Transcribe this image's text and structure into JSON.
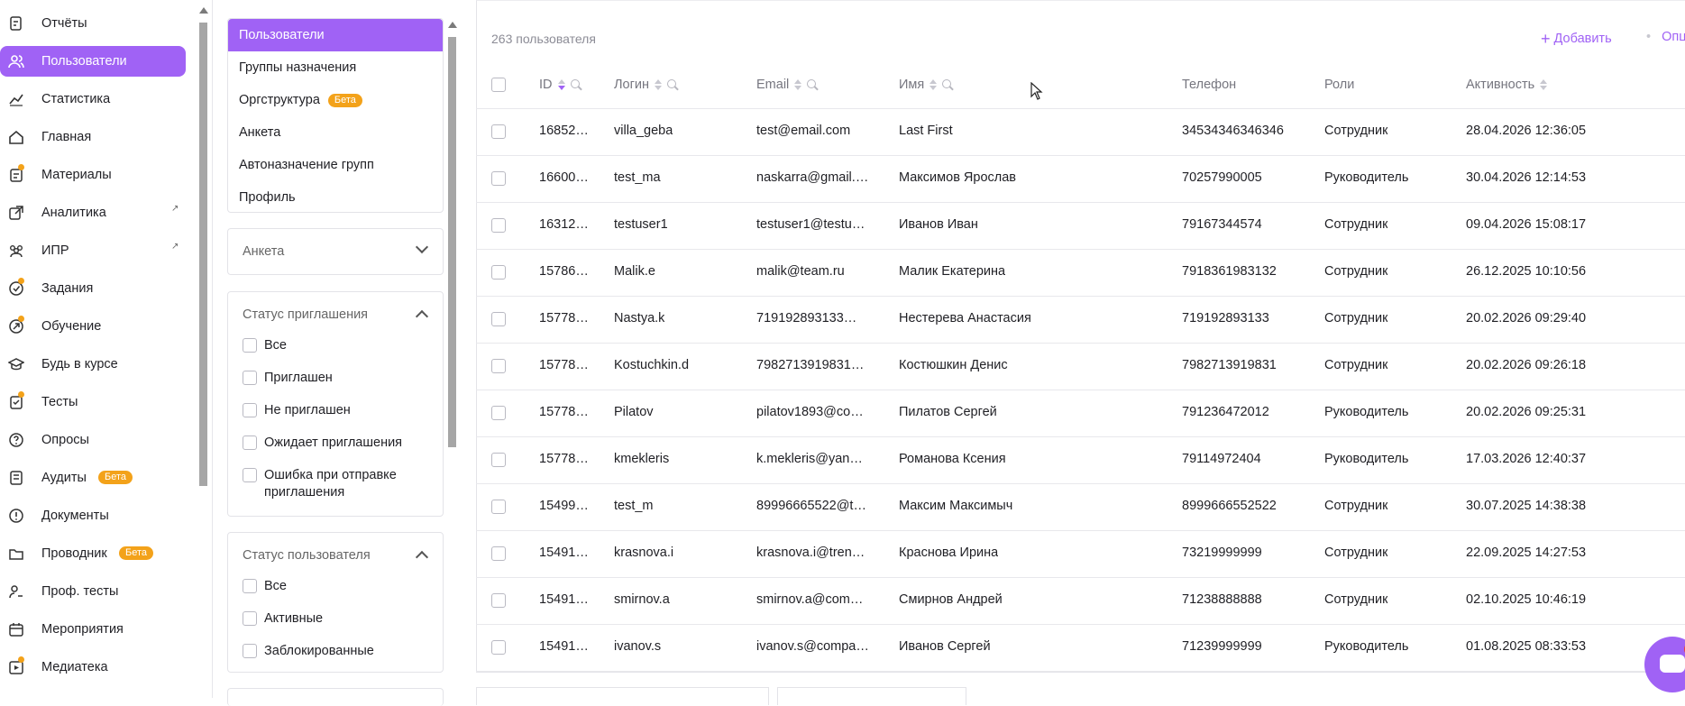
{
  "sidebar": {
    "items": [
      {
        "label": "Отчёты",
        "icon": "report-icon"
      },
      {
        "label": "Пользователи",
        "icon": "users-icon",
        "active": true
      },
      {
        "label": "Статистика",
        "icon": "chart-line-icon"
      },
      {
        "label": "Главная",
        "icon": "home-icon"
      },
      {
        "label": "Материалы",
        "icon": "materials-icon",
        "notification": true
      },
      {
        "label": "Аналитика",
        "icon": "analytics-icon",
        "external": "↗"
      },
      {
        "label": "ИПР",
        "icon": "team-icon",
        "external": "↗"
      },
      {
        "label": "Задания",
        "icon": "tasks-icon",
        "notification": true
      },
      {
        "label": "Обучение",
        "icon": "learning-icon",
        "notification": true
      },
      {
        "label": "Будь в курсе",
        "icon": "graduation-cap-icon"
      },
      {
        "label": "Тесты",
        "icon": "tests-icon",
        "notification": true
      },
      {
        "label": "Опросы",
        "icon": "survey-icon"
      },
      {
        "label": "Аудиты",
        "icon": "audit-icon",
        "badge": "Бета"
      },
      {
        "label": "Документы",
        "icon": "document-icon"
      },
      {
        "label": "Проводник",
        "icon": "folder-icon",
        "badge": "Бета"
      },
      {
        "label": "Проф. тесты",
        "icon": "prof-test-icon"
      },
      {
        "label": "Мероприятия",
        "icon": "calendar-icon"
      },
      {
        "label": "Медиатека",
        "icon": "media-icon",
        "notification": true
      }
    ]
  },
  "tabs": [
    {
      "label": "Пользователи",
      "active": true
    },
    {
      "label": "Группы назначения"
    },
    {
      "label": "Оргструктура",
      "badge": "Бета"
    },
    {
      "label": "Анкета"
    },
    {
      "label": "Автоназначение групп"
    },
    {
      "label": "Профиль"
    }
  ],
  "filters": {
    "questionnaire": {
      "title": "Анкета"
    },
    "invite_status": {
      "title": "Статус приглашения",
      "options": [
        "Все",
        "Приглашен",
        "Не приглашен",
        "Ожидает приглашения",
        "Ошибка при отправке приглашения"
      ]
    },
    "user_status": {
      "title": "Статус пользователя",
      "options": [
        "Все",
        "Активные",
        "Заблокированные"
      ]
    }
  },
  "main": {
    "total": "263 пользователя",
    "add_label": "Добавить",
    "options_label": "Опции",
    "columns": {
      "id": "ID",
      "login": "Логин",
      "email": "Email",
      "name": "Имя",
      "phone": "Телефон",
      "roles": "Роли",
      "activity": "Активность"
    },
    "rows": [
      {
        "id": "16852…",
        "login": "villa_geba",
        "email": "test@email.com",
        "name": "Last First",
        "phone": "34534346346346",
        "role": "Сотрудник",
        "activity": "28.04.2026 12:36:05"
      },
      {
        "id": "16600…",
        "login": "test_ma",
        "email": "naskarra@gmail.c…",
        "name": "Максимов Ярослав",
        "phone": "70257990005",
        "role": "Руководитель",
        "activity": "30.04.2026 12:14:53"
      },
      {
        "id": "16312…",
        "login": "testuser1",
        "email": "testuser1@testus…",
        "name": "Иванов Иван",
        "phone": "79167344574",
        "role": "Сотрудник",
        "activity": "09.04.2026 15:08:17"
      },
      {
        "id": "15786…",
        "login": "Malik.e",
        "email": "malik@team.ru",
        "name": "Малик Екатерина",
        "phone": "7918361983132",
        "role": "Сотрудник",
        "activity": "26.12.2025 10:10:56"
      },
      {
        "id": "15778…",
        "login": "Nastya.k",
        "email": "719192893133@t…",
        "name": "Нестерева Анастасия",
        "phone": "719192893133",
        "role": "Сотрудник",
        "activity": "20.02.2026 09:29:40"
      },
      {
        "id": "15778…",
        "login": "Kostuchkin.d",
        "email": "7982713919831@…",
        "name": "Костюшкин Денис",
        "phone": "7982713919831",
        "role": "Сотрудник",
        "activity": "20.02.2026 09:26:18"
      },
      {
        "id": "15778…",
        "login": "Pilatov",
        "email": "pilatov1893@com…",
        "name": "Пилатов Сергей",
        "phone": "791236472012",
        "role": "Руководитель",
        "activity": "20.02.2026 09:25:31"
      },
      {
        "id": "15778…",
        "login": "kmekleris",
        "email": "k.mekleris@yande…",
        "name": "Романова Ксения",
        "phone": "79114972404",
        "role": "Руководитель",
        "activity": "17.03.2026 12:40:37"
      },
      {
        "id": "15499…",
        "login": "test_m",
        "email": "89996665522@tw…",
        "name": "Максим Максимыч",
        "phone": "8999666552522",
        "role": "Сотрудник",
        "activity": "30.07.2025 14:38:38"
      },
      {
        "id": "15491…",
        "login": "krasnova.i",
        "email": "krasnova.i@trener.…",
        "name": "Краснова Ирина",
        "phone": "73219999999",
        "role": "Сотрудник",
        "activity": "22.09.2025 14:27:53"
      },
      {
        "id": "15491…",
        "login": "smirnov.a",
        "email": "smirnov.a@comp…",
        "name": "Смирнов Андрей",
        "phone": "71238888888",
        "role": "Сотрудник",
        "activity": "02.10.2025 10:46:19"
      },
      {
        "id": "15491…",
        "login": "ivanov.s",
        "email": "ivanov.s@compan…",
        "name": "Иванов Сергей",
        "phone": "71239999999",
        "role": "Руководитель",
        "activity": "01.08.2025 08:33:53"
      }
    ]
  },
  "colors": {
    "accent": "#a062f5",
    "beta": "#f3a21a",
    "notification": "#ef3b3b"
  }
}
